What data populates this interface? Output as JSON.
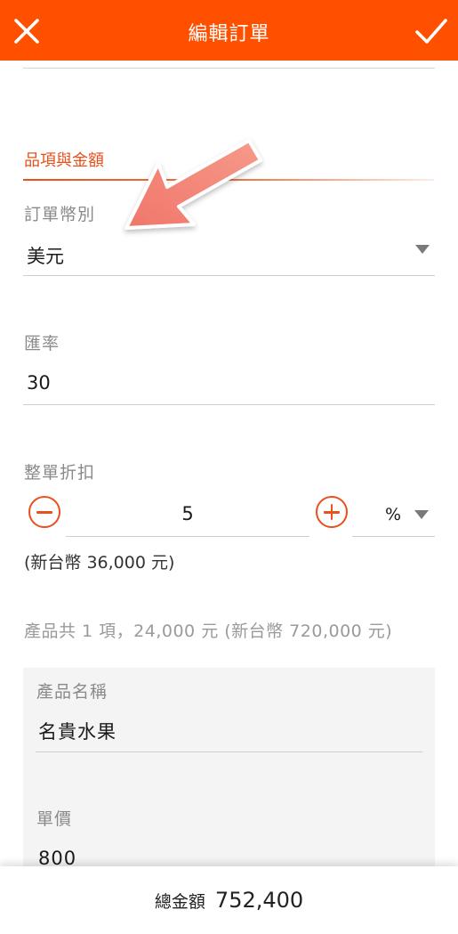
{
  "header": {
    "title": "編輯訂單",
    "close_icon": "close-icon",
    "confirm_icon": "check-icon",
    "background": "#ff5000"
  },
  "section": {
    "title": "品項與金額",
    "accent": "#e8501c"
  },
  "currency": {
    "label": "訂單幣別",
    "value": "美元"
  },
  "exchange_rate": {
    "label": "匯率",
    "value": "30"
  },
  "discount": {
    "label": "整單折扣",
    "value": "5",
    "unit": "%",
    "converted": "(新台幣 36,000 元)"
  },
  "summary": "產品共 1 項，24,000 元 (新台幣 720,000 元)",
  "product": {
    "name_label": "產品名稱",
    "name_value": "名貴水果",
    "price_label": "單價",
    "price_value": "800"
  },
  "footer": {
    "total_label": "總金額",
    "total_value": "752,400"
  }
}
